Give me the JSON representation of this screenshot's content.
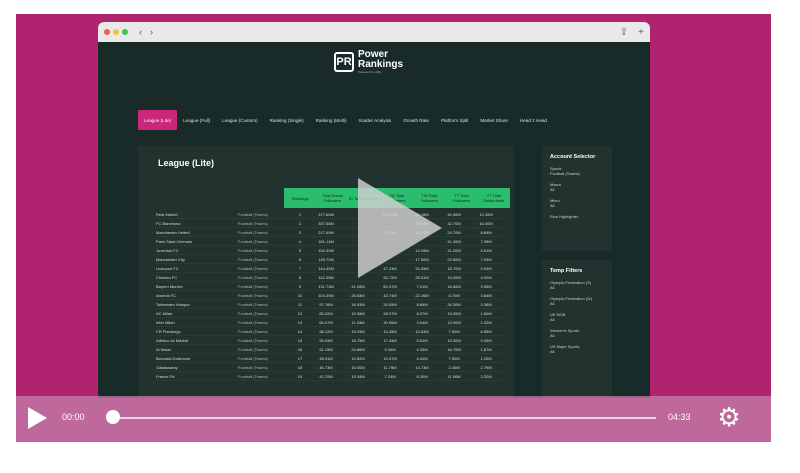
{
  "browser": {
    "traffic_lights": [
      "#f25c54",
      "#f6c244",
      "#3fc154"
    ],
    "back": "‹",
    "forward": "›"
  },
  "logo": {
    "mark": "PR",
    "title_line1": "Power",
    "title_line2": "Rankings",
    "subtitle": "Powered by Hiffly"
  },
  "nav": {
    "items": [
      "League (Lite)",
      "League (Full)",
      "League (Custom)",
      "Ranking (Single)",
      "Ranking (Multi)",
      "Scatter Analysis",
      "Growth Rate",
      "Platform Split",
      "Market Share",
      "Head 2 Head"
    ]
  },
  "panel": {
    "title": "League (Lite)",
    "headers": [
      "Rankings",
      "Total Social Followers",
      "IG Total Followers",
      "FB Total Followers",
      "TW Total Followers",
      "TT Total Followers",
      "YT Total Subscribers"
    ],
    "rows": [
      [
        "Real Madrid",
        "Football (Teams)",
        "1",
        "377.60M",
        "",
        "121.64M",
        "50.18M",
        "40.90M",
        "12.40M"
      ],
      [
        "FC Barcelona",
        "Football (Teams)",
        "2",
        "337.58M",
        "",
        "",
        "48.68M",
        "32.70M",
        "16.40M"
      ],
      [
        "Manchester United",
        "Football (Teams)",
        "3",
        "217.49M",
        "",
        "77.68M",
        "34.70M",
        "24.70M",
        "8.69M"
      ],
      [
        "Paris Saint-Germain",
        "Football (Teams)",
        "4",
        "181.14M",
        "",
        "",
        "",
        "41.40M",
        "7.39M"
      ],
      [
        "Juventus FC",
        "Football (Teams)",
        "5",
        "154.30M",
        "",
        "",
        "12.09M",
        "31.20M",
        "5.51M"
      ],
      [
        "Manchester City",
        "Football (Teams)",
        "6",
        "149.72M",
        "",
        "",
        "17.50M",
        "23.60M",
        "7.09M"
      ],
      [
        "Liverpool FC",
        "Football (Teams)",
        "7",
        "144.42M",
        "",
        "47.23M",
        "24.35M",
        "18.70M",
        "9.53M"
      ],
      [
        "Chelsea FC",
        "Football (Teams)",
        "8",
        "142.39M",
        "",
        "54.72M",
        "25.51M",
        "15.00M",
        "4.92M"
      ],
      [
        "Bayern Munich",
        "Football (Teams)",
        "9",
        "131.73M",
        "41.59M",
        "60.37M",
        "7.01M",
        "18.80M",
        "3.95M"
      ],
      [
        "Arsenal FC",
        "Football (Teams)",
        "10",
        "104.39M",
        "26.83M",
        "42.74M",
        "22.26M",
        "6.70M",
        "3.84M"
      ],
      [
        "Tottenham Hotspur",
        "Football (Teams)",
        "11",
        "97.76M",
        "16.93M",
        "34.09M",
        "8.89M",
        "34.30M",
        "3.38M"
      ],
      [
        "AC Milan",
        "Football (Teams)",
        "12",
        "65.22M",
        "15.98M",
        "28.07M",
        "8.57M",
        "15.00M",
        "1.62M"
      ],
      [
        "Inter Milan",
        "Football (Teams)",
        "13",
        "60.07M",
        "11.34M",
        "30.06M",
        "3.04M",
        "13.90M",
        "1.32M"
      ],
      [
        "CR Flamengo",
        "Football (Teams)",
        "14",
        "58.12M",
        "19.29M",
        "13.45M",
        "10.64M",
        "7.90M",
        "6.85M"
      ],
      [
        "Atlético de Madrid",
        "Football (Teams)",
        "15",
        "55.09M",
        "16.75M",
        "17.44M",
        "5.51M",
        "15.00M",
        "0.39M"
      ],
      [
        "Al Nassr",
        "Football (Teams)",
        "16",
        "51.15M",
        "24.66M",
        "5.34M",
        "4.33M",
        "16.70M",
        "1.87M"
      ],
      [
        "Borussia Dortmund",
        "Football (Teams)",
        "17",
        "48.91M",
        "19.82M",
        "15.57M",
        "4.42M",
        "7.90M",
        "1.20M"
      ],
      [
        "Galatasaray",
        "Football (Teams)",
        "18",
        "46.73M",
        "15.00M",
        "11.75M",
        "14.73M",
        "2.40M",
        "2.79M"
      ],
      [
        "France FA",
        "Football (Teams)",
        "19",
        "42.70M",
        "15.34M",
        "7.24M",
        "6.30M",
        "11.50M",
        "2.32M"
      ]
    ]
  },
  "account_selector": {
    "title": "Account Selector",
    "items": [
      {
        "label": "Sports",
        "value": "Football (Teams)"
      },
      {
        "label": "Macro",
        "value": "All"
      },
      {
        "label": "Micro",
        "value": "All"
      },
      {
        "label": "Row Highlighter",
        "value": ""
      }
    ]
  },
  "temp_filters": {
    "title": "Temp Filters",
    "items": [
      {
        "label": "Olympic Federation (S)",
        "value": "All"
      },
      {
        "label": "Olympic Federation (W)",
        "value": "All"
      },
      {
        "label": "UK NGB",
        "value": "All"
      },
      {
        "label": "Women's Sports",
        "value": "All"
      },
      {
        "label": "US Major Sports",
        "value": "All"
      }
    ]
  },
  "player": {
    "current_time": "00:00",
    "duration": "04:33",
    "progress": 0
  }
}
